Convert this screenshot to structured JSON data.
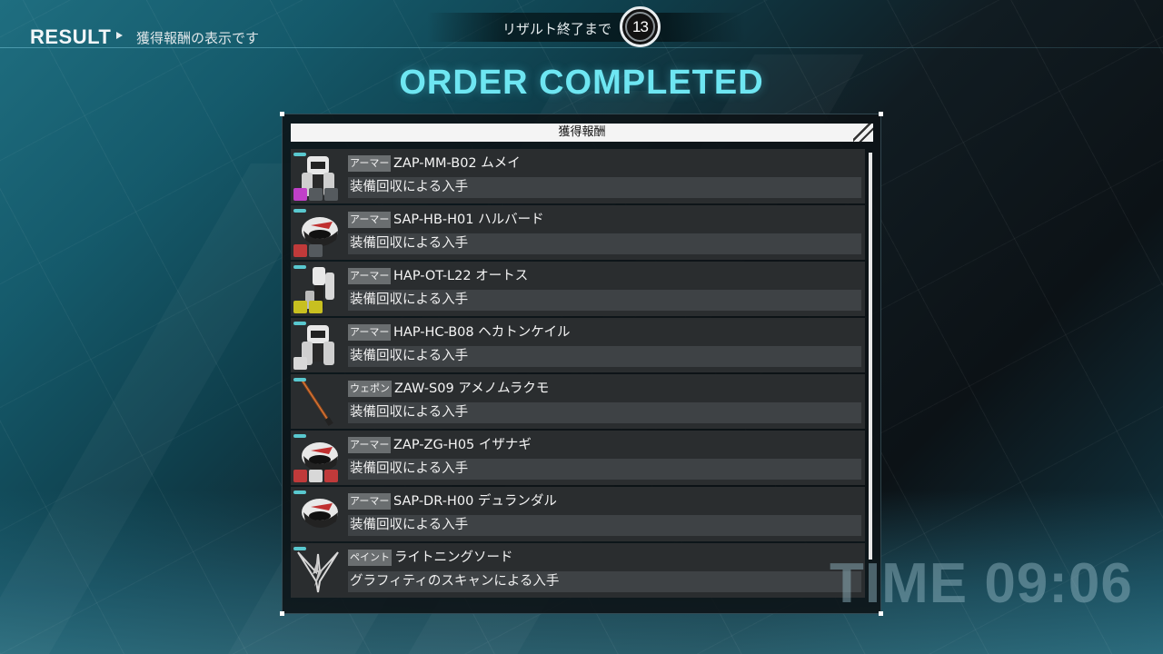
{
  "header": {
    "result_label": "RESULT",
    "description": "獲得報酬の表示です",
    "timer_label": "リザルト終了まで",
    "timer_value": "13"
  },
  "title": "ORDER COMPLETED",
  "panel": {
    "title": "獲得報酬",
    "items": [
      {
        "category": "アーマー",
        "name": "ZAP-MM-B02 ムメイ",
        "desc": "装備回収による入手",
        "icon": "armor-body-icon",
        "badges": [
          "purple",
          "gray",
          "gray"
        ]
      },
      {
        "category": "アーマー",
        "name": "SAP-HB-H01 ハルバード",
        "desc": "装備回収による入手",
        "icon": "armor-helmet-icon",
        "badges": [
          "red",
          "gray"
        ]
      },
      {
        "category": "アーマー",
        "name": "HAP-OT-L22 オートス",
        "desc": "装備回収による入手",
        "icon": "armor-legs-icon",
        "badges": [
          "yellow",
          "yellow"
        ]
      },
      {
        "category": "アーマー",
        "name": "HAP-HC-B08 ヘカトンケイル",
        "desc": "装備回収による入手",
        "icon": "armor-body-icon",
        "badges": [
          "white"
        ]
      },
      {
        "category": "ウェポン",
        "name": "ZAW-S09 アメノムラクモ",
        "desc": "装備回収による入手",
        "icon": "sword-icon",
        "badges": []
      },
      {
        "category": "アーマー",
        "name": "ZAP-ZG-H05 イザナギ",
        "desc": "装備回収による入手",
        "icon": "armor-helmet-icon",
        "badges": [
          "red",
          "white",
          "red"
        ]
      },
      {
        "category": "アーマー",
        "name": "SAP-DR-H00 デュランダル",
        "desc": "装備回収による入手",
        "icon": "armor-helmet-icon",
        "badges": []
      },
      {
        "category": "ペイント",
        "name": "ライトニングソード",
        "desc": "グラフィティのスキャンによる入手",
        "icon": "graffiti-icon",
        "badges": []
      }
    ]
  },
  "time": "TIME 09:06",
  "colors": {
    "accent": "#6ee6f2",
    "row_bg": "#2a2d2f",
    "sub_bar": "#3e4245",
    "tag_bg": "#6a6e70",
    "badge_purple": "#c040c8",
    "badge_red": "#c03a3a",
    "badge_yellow": "#c8c020",
    "badge_gray": "#555a5e",
    "badge_white": "#d8d8d8"
  }
}
